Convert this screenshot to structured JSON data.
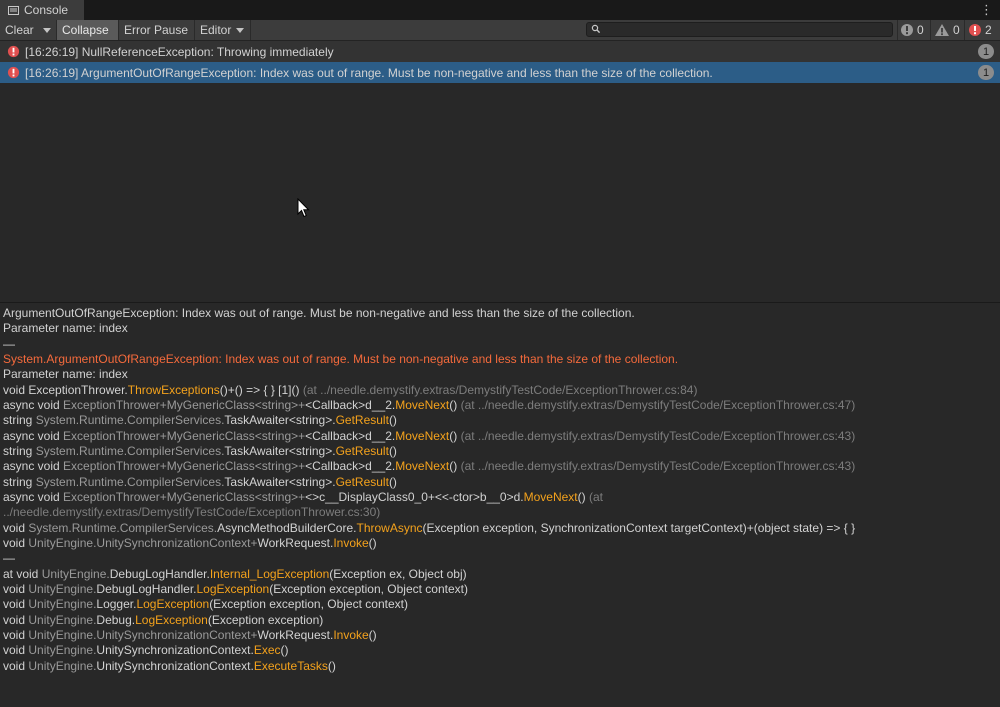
{
  "tab": {
    "title": "Console"
  },
  "toolbar": {
    "clear": "Clear",
    "collapse": "Collapse",
    "error_pause": "Error Pause",
    "editor": "Editor",
    "search_placeholder": "",
    "info_count": "0",
    "warn_count": "0",
    "error_count": "2"
  },
  "colors": {
    "selected_row": "#2c5d87",
    "error": "#f46a3c",
    "method": "#f4a21c",
    "error_icon": "#e05050"
  },
  "log_entries": [
    {
      "text": "[16:26:19] NullReferenceException: Throwing immediately",
      "count": "1",
      "selected": false
    },
    {
      "text": "[16:26:19] ArgumentOutOfRangeException: Index was out of range. Must be non-negative and less than the size of the collection.",
      "count": "1",
      "selected": true
    }
  ],
  "detail": {
    "header1": "ArgumentOutOfRangeException: Index was out of range. Must be non-negative and less than the size of the collection.",
    "header2": "Parameter name: index",
    "sep1": "—",
    "exc1": "System.ArgumentOutOfRangeException: Index was out of range. Must be non-negative and less than the size of the collection.",
    "exc2": "Parameter name: index",
    "f1": {
      "a": "void ",
      "b": "ExceptionThrower.",
      "c": "ThrowExceptions",
      "d": "()+() => { } [1]()",
      "e": " (at ../needle.demystify.extras/DemystifyTestCode/ExceptionThrower.cs:84)"
    },
    "f2": {
      "a": "async void ",
      "b": "ExceptionThrower+MyGenericClass<string>+",
      "c": "<Callback>d__2.",
      "d": "MoveNext",
      "e": "()",
      "f": " (at ../needle.demystify.extras/DemystifyTestCode/ExceptionThrower.cs:47)"
    },
    "f3": {
      "a": "string ",
      "b": "System.Runtime.CompilerServices.",
      "c": "TaskAwaiter<string>.",
      "d": "GetResult",
      "e": "()"
    },
    "f4": {
      "a": "async void ",
      "b": "ExceptionThrower+MyGenericClass<string>+",
      "c": "<Callback>d__2.",
      "d": "MoveNext",
      "e": "()",
      "f": " (at ../needle.demystify.extras/DemystifyTestCode/ExceptionThrower.cs:43)"
    },
    "f5": {
      "a": "string ",
      "b": "System.Runtime.CompilerServices.",
      "c": "TaskAwaiter<string>.",
      "d": "GetResult",
      "e": "()"
    },
    "f6": {
      "a": "async void ",
      "b": "ExceptionThrower+MyGenericClass<string>+",
      "c": "<Callback>d__2.",
      "d": "MoveNext",
      "e": "()",
      "f": " (at ../needle.demystify.extras/DemystifyTestCode/ExceptionThrower.cs:43)"
    },
    "f7": {
      "a": "string ",
      "b": "System.Runtime.CompilerServices.",
      "c": "TaskAwaiter<string>.",
      "d": "GetResult",
      "e": "()"
    },
    "f8": {
      "a": "async void ",
      "b": "ExceptionThrower+MyGenericClass<string>+",
      "c": "<>c__DisplayClass0_0+<<-ctor>b__0>d.",
      "d": "MoveNext",
      "e": "()",
      "f": " (at"
    },
    "f8b": "../needle.demystify.extras/DemystifyTestCode/ExceptionThrower.cs:30)",
    "f9": {
      "a": "void ",
      "b": "System.Runtime.CompilerServices.",
      "c": "AsyncMethodBuilderCore.",
      "d": "ThrowAsync",
      "e": "(Exception exception, SynchronizationContext targetContext)+(object state) => { }"
    },
    "f10": {
      "a": "void ",
      "b": "UnityEngine.",
      "c": "UnitySynchronizationContext+",
      "d": "WorkRequest.",
      "e": "Invoke",
      "f": "()"
    },
    "sep2": "—",
    "g1": {
      "a": "at void ",
      "b": "UnityEngine.",
      "c": "DebugLogHandler.",
      "d": "Internal_LogException",
      "e": "(Exception ex, Object obj)"
    },
    "g2": {
      "a": "void ",
      "b": "UnityEngine.",
      "c": "DebugLogHandler.",
      "d": "LogException",
      "e": "(Exception exception, Object context)"
    },
    "g3": {
      "a": "void ",
      "b": "UnityEngine.",
      "c": "Logger.",
      "d": "LogException",
      "e": "(Exception exception, Object context)"
    },
    "g4": {
      "a": "void ",
      "b": "UnityEngine.",
      "c": "Debug.",
      "d": "LogException",
      "e": "(Exception exception)"
    },
    "g5": {
      "a": "void ",
      "b": "UnityEngine.",
      "c": "UnitySynchronizationContext+",
      "d": "WorkRequest.",
      "e": "Invoke",
      "f": "()"
    },
    "g6": {
      "a": "void ",
      "b": "UnityEngine.",
      "c": "UnitySynchronizationContext.",
      "d": "Exec",
      "e": "()"
    },
    "g7": {
      "a": "void ",
      "b": "UnityEngine.",
      "c": "UnitySynchronizationContext.",
      "d": "ExecuteTasks",
      "e": "()"
    }
  }
}
